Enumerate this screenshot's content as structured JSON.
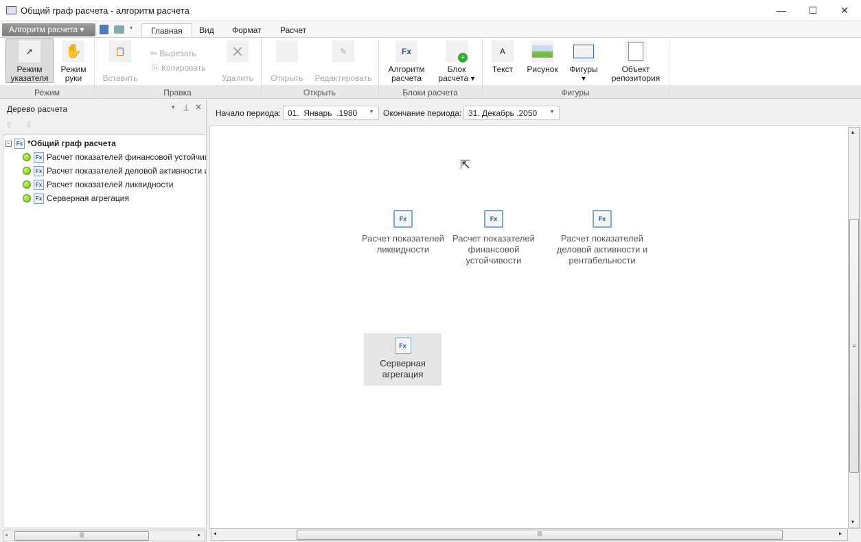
{
  "window": {
    "title": "Общий граф расчета - алгоритм расчета",
    "minimize": "—",
    "maximize": "☐",
    "close": "✕"
  },
  "app_menu": "Алгоритм расчета ▾",
  "tabs": [
    "Главная",
    "Вид",
    "Формат",
    "Расчет"
  ],
  "ribbon": {
    "mode": {
      "label": "Режим",
      "pointer": "Режим указателя",
      "hand": "Режим руки"
    },
    "edit": {
      "label": "Правка",
      "paste": "Вставить",
      "cut": "Вырезать",
      "copy": "Копировать",
      "delete": "Удалить"
    },
    "open": {
      "label": "Открыть",
      "open": "Открыть",
      "edit": "Редактировать"
    },
    "blocks": {
      "label": "Блоки расчета",
      "algorithm": "Алгоритм расчета",
      "block": "Блок расчета"
    },
    "shapes": {
      "label": "Фигуры",
      "text": "Текст",
      "picture": "Рисунок",
      "shapes": "Фигуры",
      "repo": "Объект репозитория"
    }
  },
  "tree_panel": {
    "title": "Дерево расчета",
    "root": "*Общий граф расчета",
    "items": [
      "Расчет показателей финансовой устойчивости",
      "Расчет показателей деловой активности и рентабельности",
      "Расчет показателей ликвидности",
      "Серверная агрегация"
    ]
  },
  "period": {
    "start_label": "Начало периода:",
    "start_value": "01.  Январь  .1980",
    "end_label": "Окончание периода:",
    "end_value": "31. Декабрь .2050"
  },
  "canvas": {
    "nodes": [
      "Расчет показателей ликвидности",
      "Расчет показателей финансовой устойчивости",
      "Расчет показателей деловой активности и рентабельности"
    ],
    "server_block": "Серверная агрегация"
  }
}
